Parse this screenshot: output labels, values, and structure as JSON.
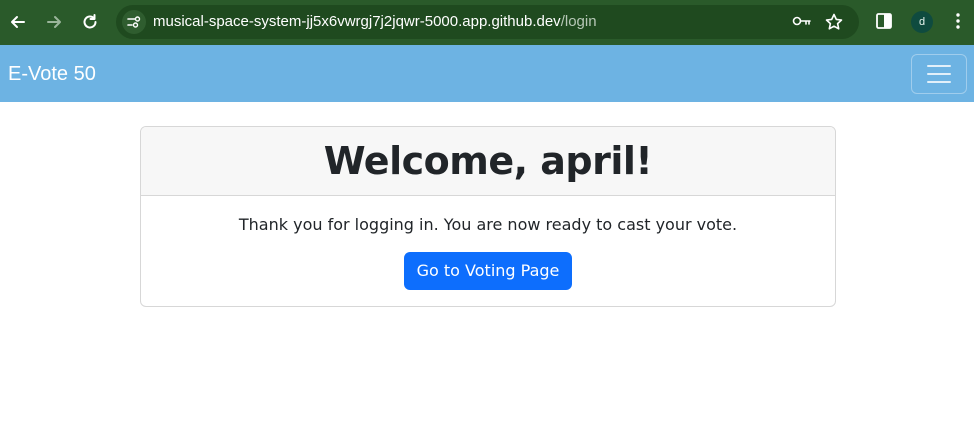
{
  "browser": {
    "url_host": "musical-space-system-jj5x6vwrgj7j2jqwr-5000.app.github.dev",
    "url_path": "/login",
    "profile_initial": "d",
    "colors": {
      "frame": "#2a5a2a",
      "omnibox": "#1f4a1f"
    },
    "icons": [
      "back-icon",
      "forward-icon",
      "reload-icon",
      "site-info-icon",
      "key-icon",
      "star-icon",
      "side-panel-icon",
      "more-menu-icon"
    ]
  },
  "navbar": {
    "brand": "E-Vote 50",
    "colors": {
      "background": "#6db3e3"
    },
    "toggler_icon": "hamburger-icon"
  },
  "card": {
    "title": "Welcome, april!",
    "message": "Thank you for logging in. You are now ready to cast your vote.",
    "button_label": "Go to Voting Page",
    "colors": {
      "button": "#0d6efd",
      "header": "#f7f7f7"
    }
  }
}
